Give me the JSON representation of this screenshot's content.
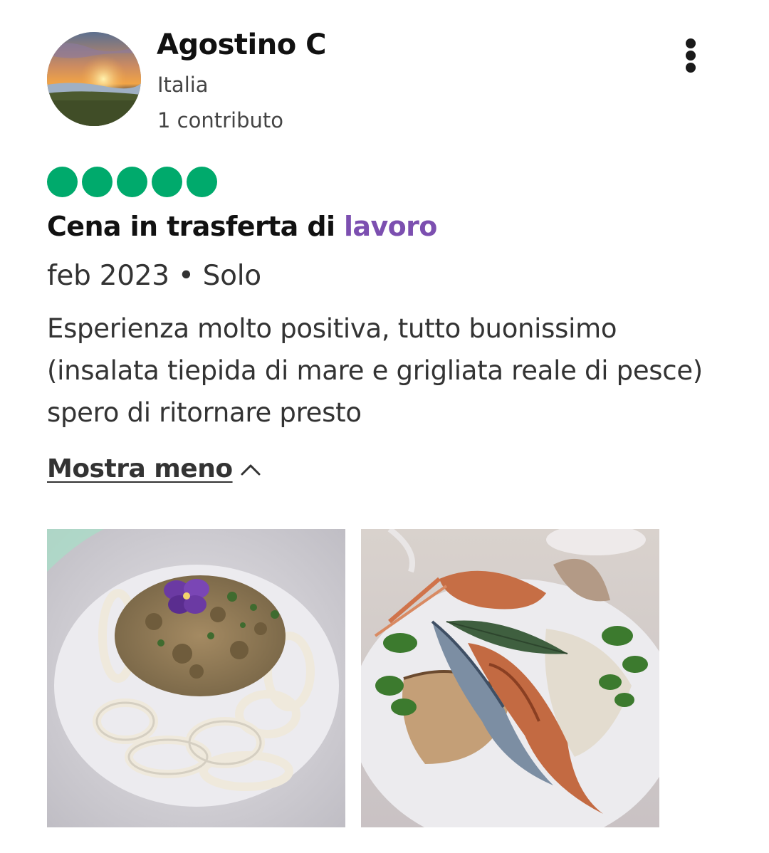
{
  "user": {
    "name": "Agostino C",
    "location": "Italia",
    "contributions": "1 contributo",
    "avatar_icon": "sunset-landscape-avatar"
  },
  "menu": {
    "icon": "more-vertical-icon"
  },
  "rating": {
    "value": 5,
    "max": 5,
    "color": "#00aa6c"
  },
  "review": {
    "title_main": "Cena in trasferta di ",
    "title_highlight": "lavoro",
    "title_highlight_color": "#7c4fb0",
    "date": "feb 2023",
    "separator": "•",
    "trip_type": "Solo",
    "body": "Esperienza molto positiva, tutto buonissimo (insalata tiepida di mare e grigliata reale di pesce) spero di ritornare presto",
    "show_less_label": "Mostra meno",
    "show_less_icon": "chevron-up-icon"
  },
  "photos": [
    {
      "subject": "insalata-tiepida-di-mare-photo"
    },
    {
      "subject": "grigliata-reale-di-pesce-photo"
    }
  ]
}
